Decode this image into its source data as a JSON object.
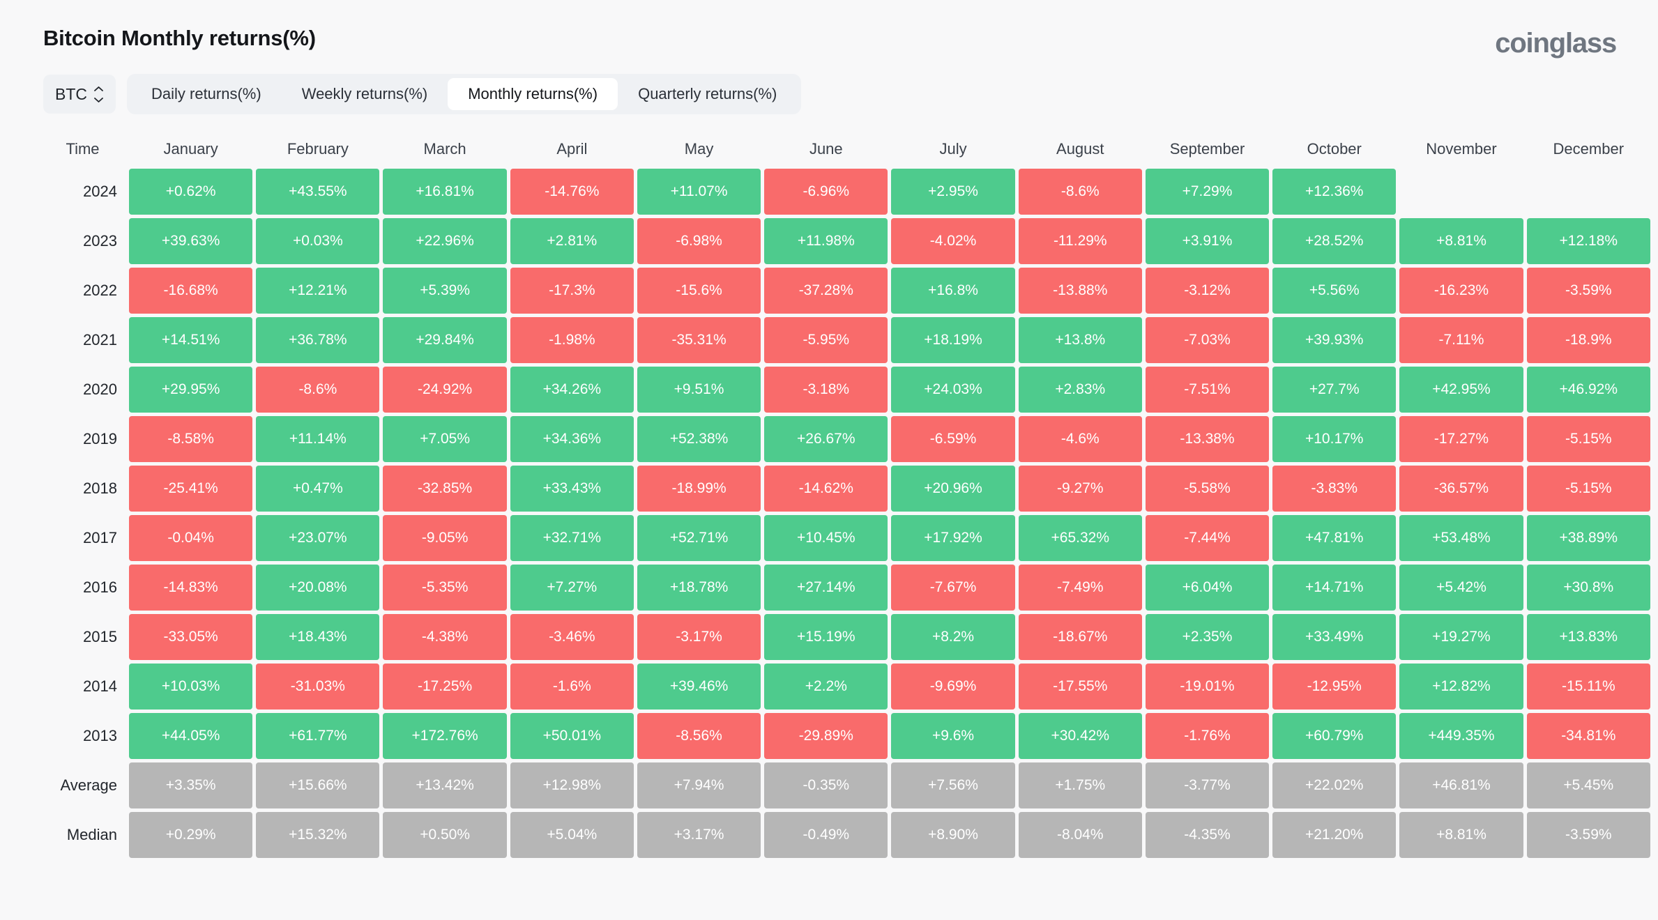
{
  "header": {
    "title": "Bitcoin Monthly returns(%)",
    "brand": "coinglass"
  },
  "controls": {
    "symbol": "BTC",
    "symbol_icon": "chevron-up-down-icon",
    "tabs": [
      {
        "label": "Daily returns(%)",
        "active": false
      },
      {
        "label": "Weekly returns(%)",
        "active": false
      },
      {
        "label": "Monthly returns(%)",
        "active": true
      },
      {
        "label": "Quarterly returns(%)",
        "active": false
      }
    ]
  },
  "colors": {
    "positive": "#4ecb8d",
    "negative": "#f96b6b",
    "stat": "#b6b6b6",
    "background": "#f8f8f9",
    "tabbar": "#eff1f4",
    "brand": "#6f7680"
  },
  "chart_data": {
    "type": "heatmap",
    "title": "Bitcoin Monthly returns(%)",
    "xlabel": "",
    "ylabel": "Time",
    "legend": "",
    "row_header": "Time",
    "categories": [
      "January",
      "February",
      "March",
      "April",
      "May",
      "June",
      "July",
      "August",
      "September",
      "October",
      "November",
      "December"
    ],
    "rows": [
      "2024",
      "2023",
      "2022",
      "2021",
      "2020",
      "2019",
      "2018",
      "2017",
      "2016",
      "2015",
      "2014",
      "2013",
      "Average",
      "Median"
    ],
    "values": [
      [
        "+0.62%",
        "+43.55%",
        "+16.81%",
        "-14.76%",
        "+11.07%",
        "-6.96%",
        "+2.95%",
        "-8.6%",
        "+7.29%",
        "+12.36%",
        "",
        ""
      ],
      [
        "+39.63%",
        "+0.03%",
        "+22.96%",
        "+2.81%",
        "-6.98%",
        "+11.98%",
        "-4.02%",
        "-11.29%",
        "+3.91%",
        "+28.52%",
        "+8.81%",
        "+12.18%"
      ],
      [
        "-16.68%",
        "+12.21%",
        "+5.39%",
        "-17.3%",
        "-15.6%",
        "-37.28%",
        "+16.8%",
        "-13.88%",
        "-3.12%",
        "+5.56%",
        "-16.23%",
        "-3.59%"
      ],
      [
        "+14.51%",
        "+36.78%",
        "+29.84%",
        "-1.98%",
        "-35.31%",
        "-5.95%",
        "+18.19%",
        "+13.8%",
        "-7.03%",
        "+39.93%",
        "-7.11%",
        "-18.9%"
      ],
      [
        "+29.95%",
        "-8.6%",
        "-24.92%",
        "+34.26%",
        "+9.51%",
        "-3.18%",
        "+24.03%",
        "+2.83%",
        "-7.51%",
        "+27.7%",
        "+42.95%",
        "+46.92%"
      ],
      [
        "-8.58%",
        "+11.14%",
        "+7.05%",
        "+34.36%",
        "+52.38%",
        "+26.67%",
        "-6.59%",
        "-4.6%",
        "-13.38%",
        "+10.17%",
        "-17.27%",
        "-5.15%"
      ],
      [
        "-25.41%",
        "+0.47%",
        "-32.85%",
        "+33.43%",
        "-18.99%",
        "-14.62%",
        "+20.96%",
        "-9.27%",
        "-5.58%",
        "-3.83%",
        "-36.57%",
        "-5.15%"
      ],
      [
        "-0.04%",
        "+23.07%",
        "-9.05%",
        "+32.71%",
        "+52.71%",
        "+10.45%",
        "+17.92%",
        "+65.32%",
        "-7.44%",
        "+47.81%",
        "+53.48%",
        "+38.89%"
      ],
      [
        "-14.83%",
        "+20.08%",
        "-5.35%",
        "+7.27%",
        "+18.78%",
        "+27.14%",
        "-7.67%",
        "-7.49%",
        "+6.04%",
        "+14.71%",
        "+5.42%",
        "+30.8%"
      ],
      [
        "-33.05%",
        "+18.43%",
        "-4.38%",
        "-3.46%",
        "-3.17%",
        "+15.19%",
        "+8.2%",
        "-18.67%",
        "+2.35%",
        "+33.49%",
        "+19.27%",
        "+13.83%"
      ],
      [
        "+10.03%",
        "-31.03%",
        "-17.25%",
        "-1.6%",
        "+39.46%",
        "+2.2%",
        "-9.69%",
        "-17.55%",
        "-19.01%",
        "-12.95%",
        "+12.82%",
        "-15.11%"
      ],
      [
        "+44.05%",
        "+61.77%",
        "+172.76%",
        "+50.01%",
        "-8.56%",
        "-29.89%",
        "+9.6%",
        "+30.42%",
        "-1.76%",
        "+60.79%",
        "+449.35%",
        "-34.81%"
      ],
      [
        "+3.35%",
        "+15.66%",
        "+13.42%",
        "+12.98%",
        "+7.94%",
        "-0.35%",
        "+7.56%",
        "+1.75%",
        "-3.77%",
        "+22.02%",
        "+46.81%",
        "+5.45%"
      ],
      [
        "+0.29%",
        "+15.32%",
        "+0.50%",
        "+5.04%",
        "+3.17%",
        "-0.49%",
        "+8.90%",
        "-8.04%",
        "-4.35%",
        "+21.20%",
        "+8.81%",
        "-3.59%"
      ]
    ],
    "stat_rows": [
      "Average",
      "Median"
    ]
  }
}
